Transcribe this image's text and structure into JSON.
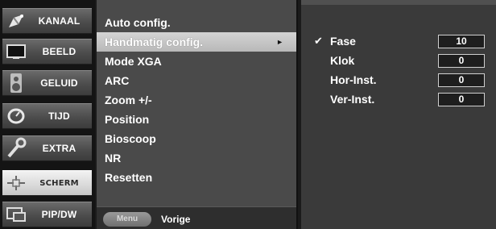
{
  "categories": [
    {
      "label": "KANAAL",
      "icon": "satellite-dish-icon",
      "active": false
    },
    {
      "label": "BEELD",
      "icon": "tv-screen-icon",
      "active": false
    },
    {
      "label": "GELUID",
      "icon": "speaker-icon",
      "active": false
    },
    {
      "label": "TIJD",
      "icon": "clock-icon",
      "active": false
    },
    {
      "label": "EXTRA",
      "icon": "wrench-icon",
      "active": false
    },
    {
      "label": "SCHERM",
      "icon": "screen-adjust-icon",
      "active": true
    },
    {
      "label": "PIP/DW",
      "icon": "pip-window-icon",
      "active": false
    }
  ],
  "menu": {
    "items": [
      {
        "label": "Auto config."
      },
      {
        "label": "Handmatig config.",
        "selected": true,
        "arrow": "►"
      },
      {
        "label": "Mode XGA"
      },
      {
        "label": "ARC"
      },
      {
        "label": "Zoom +/-"
      },
      {
        "label": "Position"
      },
      {
        "label": "Bioscoop"
      },
      {
        "label": "NR"
      },
      {
        "label": "Resetten"
      }
    ],
    "footer": {
      "button": "Menu",
      "label": "Vorige"
    }
  },
  "panel": {
    "rows": [
      {
        "check": "✔",
        "label": "Fase",
        "value": "10"
      },
      {
        "check": "",
        "label": "Klok",
        "value": "0"
      },
      {
        "check": "",
        "label": "Hor-Inst.",
        "value": "0"
      },
      {
        "check": "",
        "label": "Ver-Inst.",
        "value": "0"
      }
    ]
  },
  "colors": {
    "selected_bar": "#c8c8c8",
    "menu_bg": "#4a4a4a",
    "panel_bg": "#3a3a3a"
  }
}
